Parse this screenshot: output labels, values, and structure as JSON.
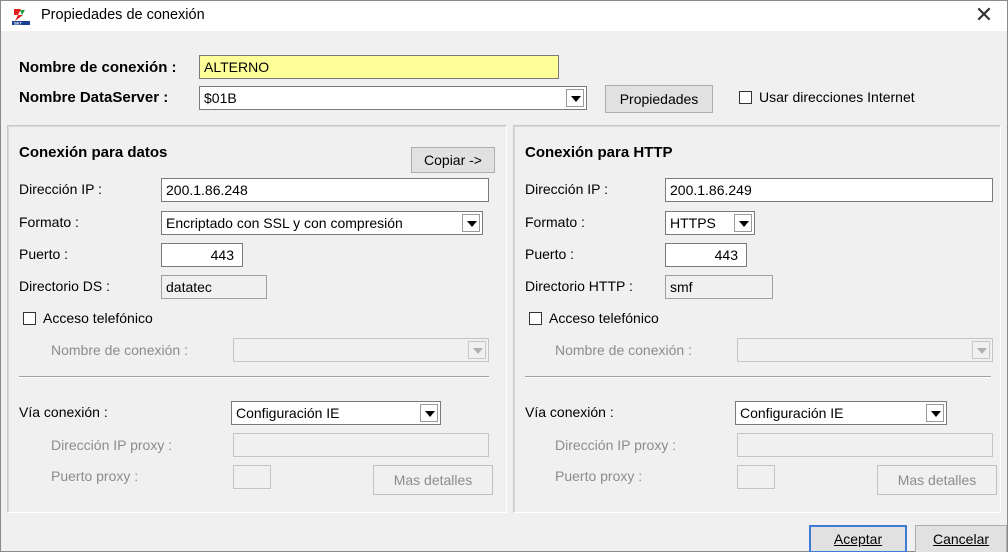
{
  "window": {
    "title": "Propiedades de conexión",
    "close_glyph": "✕",
    "icon": "set-logo-icon"
  },
  "header": {
    "connection_name_label": "Nombre de conexión :",
    "connection_name_value": "ALTERNO",
    "dataserver_label": "Nombre DataServer :",
    "dataserver_value": "$01B",
    "properties_button": "Propiedades",
    "use_internet_label": "Usar direcciones Internet",
    "use_internet_checked": false
  },
  "data_connection": {
    "title": "Conexión para datos",
    "copy_button": "Copiar ->",
    "ip_label": "Dirección IP :",
    "ip_value": "200.1.86.248",
    "format_label": "Formato :",
    "format_value": "Encriptado con SSL y con compresión",
    "port_label": "Puerto :",
    "port_value": "443",
    "dir_label": "Directorio DS :",
    "dir_value": "datatec",
    "dialup_label": "Acceso telefónico",
    "dialup_checked": false,
    "dialup_name_label": "Nombre de conexión :",
    "via_label": "Vía conexión :",
    "via_value": "Configuración IE",
    "proxy_ip_label": "Dirección IP proxy :",
    "proxy_port_label": "Puerto proxy :",
    "details_button": "Mas detalles"
  },
  "http_connection": {
    "title": "Conexión para HTTP",
    "ip_label": "Dirección IP :",
    "ip_value": "200.1.86.249",
    "format_label": "Formato :",
    "format_value": "HTTPS",
    "port_label": "Puerto :",
    "port_value": "443",
    "dir_label": "Directorio HTTP :",
    "dir_value": "smf",
    "dialup_label": "Acceso telefónico",
    "dialup_checked": false,
    "dialup_name_label": "Nombre de conexión :",
    "via_label": "Vía conexión :",
    "via_value": "Configuración IE",
    "proxy_ip_label": "Dirección IP proxy :",
    "proxy_port_label": "Puerto proxy :",
    "details_button": "Mas detalles"
  },
  "footer": {
    "accept_button": "Aceptar",
    "cancel_button": "Cancelar"
  }
}
